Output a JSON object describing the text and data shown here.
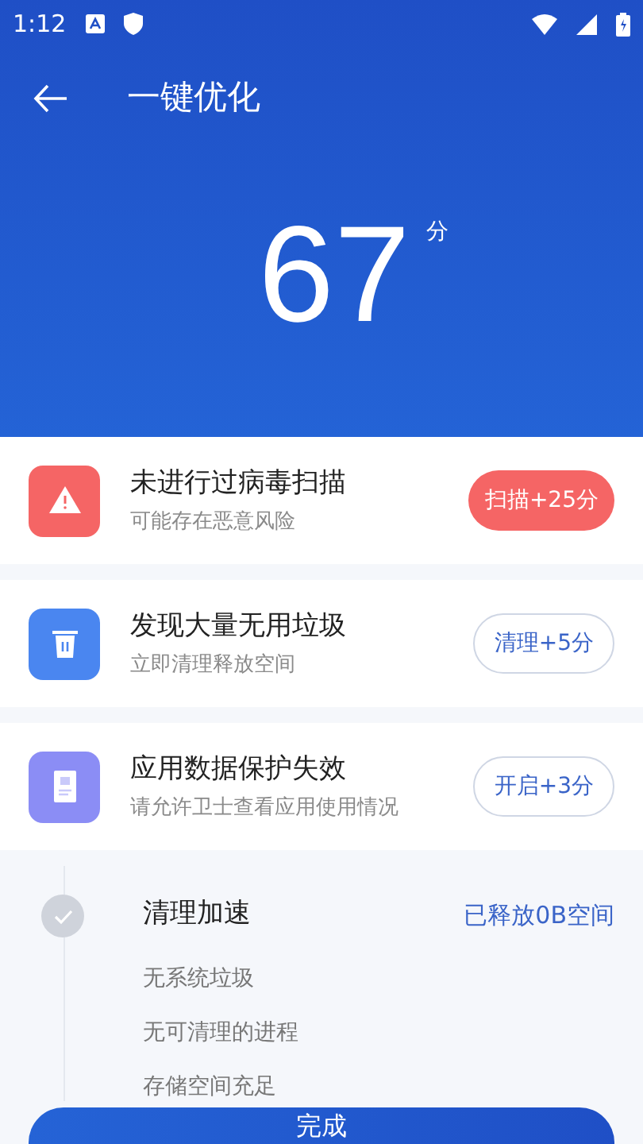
{
  "status_bar": {
    "time": "1:12"
  },
  "toolbar": {
    "title": "一键优化"
  },
  "score": {
    "value": "67",
    "unit": "分"
  },
  "issues": [
    {
      "kind": "warning",
      "title": "未进行过病毒扫描",
      "subtitle": "可能存在恶意风险",
      "action": "扫描+25分",
      "primary": true
    },
    {
      "kind": "trash",
      "title": "发现大量无用垃圾",
      "subtitle": "立即清理释放空间",
      "action": "清理+5分",
      "primary": false
    },
    {
      "kind": "document",
      "title": "应用数据保护失效",
      "subtitle": "请允许卫士查看应用使用情况",
      "action": "开启+3分",
      "primary": false
    }
  ],
  "results": {
    "title": "清理加速",
    "done": true,
    "summary": "已释放0B空间",
    "items": [
      "无系统垃圾",
      "无可清理的进程",
      "存储空间充足"
    ]
  },
  "done_button": "完成"
}
